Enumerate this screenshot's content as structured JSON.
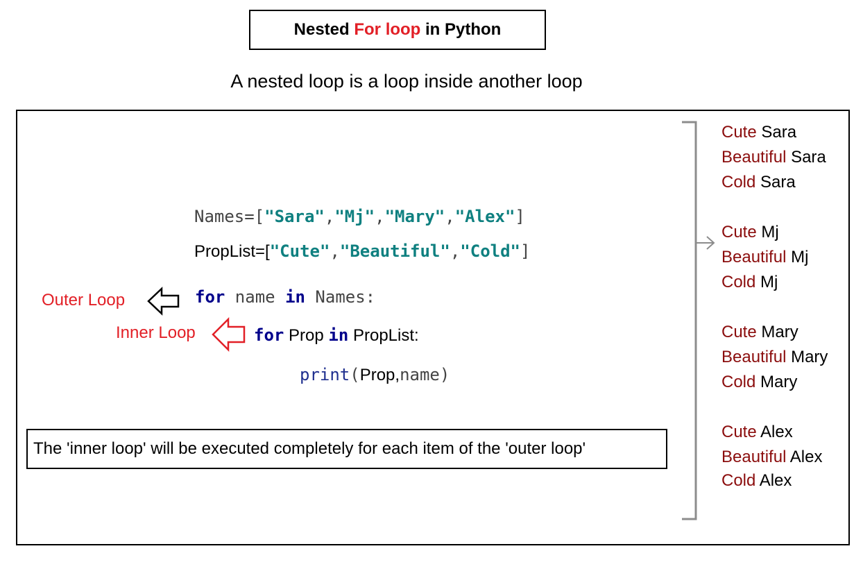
{
  "title": {
    "part1": "Nested ",
    "part2": "For loop",
    "part3": " in Python"
  },
  "subtitle": "A nested loop is a loop inside another loop",
  "code": {
    "names_prefix": "Names=[",
    "names": [
      "\"Sara\"",
      "\"Mj\"",
      "\"Mary\"",
      "\"Alex\""
    ],
    "names_suffix": "]",
    "proplist_prefix": "PropList=[",
    "props": [
      "\"Cute\"",
      "\"Beautiful\"",
      "\"Cold\""
    ],
    "proplist_suffix": "]",
    "outer_for": "for",
    "outer_var": " name ",
    "outer_in": "in",
    "outer_iter": " Names:",
    "inner_for": "for",
    "inner_var": " Prop ",
    "inner_in": "in",
    "inner_iter": " PropList:",
    "print_fn": "print",
    "print_args_open": "(",
    "print_arg1": "Prop,",
    "print_arg2": "name",
    "print_args_close": ")"
  },
  "labels": {
    "outer": "Outer Loop",
    "inner": "Inner Loop"
  },
  "note": "The 'inner loop' will be executed completely for each item of the 'outer loop'",
  "output": [
    {
      "prop": "Cute",
      "name": "Sara"
    },
    {
      "prop": "Beautiful",
      "name": "Sara"
    },
    {
      "prop": "Cold",
      "name": "Sara"
    },
    {
      "prop": "Cute",
      "name": "Mj"
    },
    {
      "prop": "Beautiful",
      "name": "Mj"
    },
    {
      "prop": "Cold",
      "name": "Mj"
    },
    {
      "prop": "Cute",
      "name": "Mary"
    },
    {
      "prop": "Beautiful",
      "name": "Mary"
    },
    {
      "prop": "Cold",
      "name": "Mary"
    },
    {
      "prop": "Cute",
      "name": "Alex"
    },
    {
      "prop": "Beautiful",
      "name": "Alex"
    },
    {
      "prop": "Cold",
      "name": "Alex"
    }
  ],
  "colors": {
    "title_accent": "#e21f26",
    "string": "#0f8080",
    "keyword": "#00008b",
    "output_prop": "#8b0d0d",
    "bracket": "#8c8c8c"
  }
}
